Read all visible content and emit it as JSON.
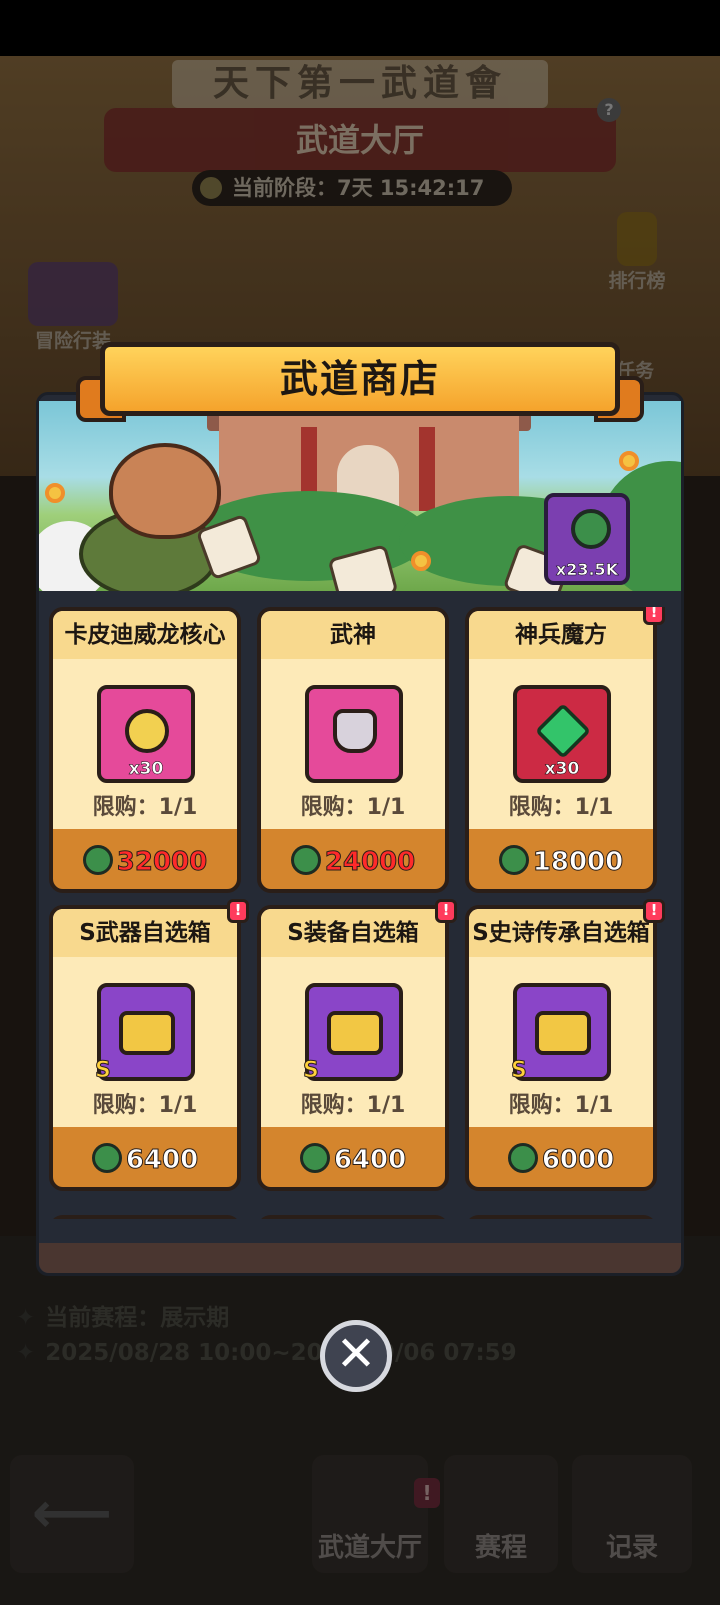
{
  "background": {
    "sign_text": "天下第一武道會",
    "hall_title": "武道大厅",
    "help_label": "?",
    "stage_label": "当前阶段：7天 15:42:17",
    "side_buttons": {
      "adventure": "冒险行装",
      "ranking": "排行榜",
      "tasks": "任务"
    },
    "season_label": "当前赛程：展示期",
    "season_dates": "2025/08/28 10:00~2025/09/06 07:59",
    "nav": {
      "back_label": "⟵",
      "hall": "武道大厅",
      "match": "赛程",
      "record": "记录",
      "alert": "!"
    }
  },
  "shop": {
    "title": "武道商店",
    "currency_amount": "x23.5K",
    "items": [
      {
        "name": "卡皮迪威龙核心",
        "icon": "moped-core-icon",
        "qty": "x30",
        "limit": "限购：1/1",
        "price": "32000",
        "price_color": "red",
        "alert": false,
        "grade": ""
      },
      {
        "name": "武神",
        "icon": "armor-suit-icon",
        "qty": "",
        "limit": "限购：1/1",
        "price": "24000",
        "price_color": "red",
        "alert": false,
        "grade": ""
      },
      {
        "name": "神兵魔方",
        "icon": "green-gem-icon",
        "qty": "x30",
        "limit": "限购：1/1",
        "price": "18000",
        "price_color": "white",
        "alert": true,
        "grade": ""
      },
      {
        "name": "S武器自选箱",
        "icon": "weapon-chest-icon",
        "qty": "",
        "limit": "限购：1/1",
        "price": "6400",
        "price_color": "white",
        "alert": true,
        "grade": "S"
      },
      {
        "name": "S装备自选箱",
        "icon": "gear-chest-icon",
        "qty": "",
        "limit": "限购：1/1",
        "price": "6400",
        "price_color": "white",
        "alert": true,
        "grade": "S"
      },
      {
        "name": "S史诗传承自选箱",
        "icon": "epic-chest-icon",
        "qty": "",
        "limit": "限购：1/1",
        "price": "6000",
        "price_color": "white",
        "alert": true,
        "grade": "S"
      }
    ],
    "alert_label": "!",
    "close_label": "✕"
  },
  "colors": {
    "accent_red": "#ff2a2a",
    "currency_green": "#3c8f4a",
    "card_orange": "#d4852d",
    "alert_pink": "#ff3b5c"
  }
}
